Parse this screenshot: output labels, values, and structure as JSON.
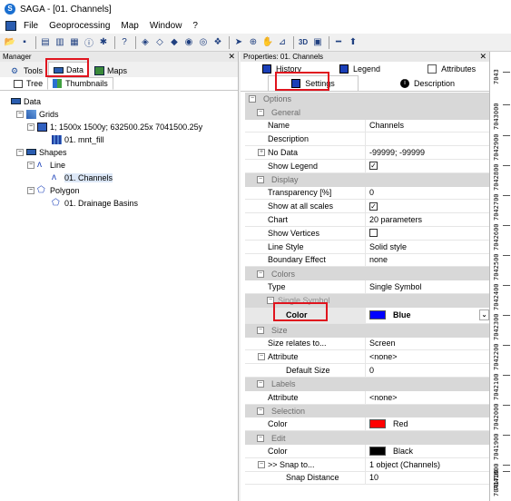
{
  "window": {
    "title": "SAGA - [01. Channels]"
  },
  "menu": [
    "File",
    "Geoprocessing",
    "Map",
    "Window",
    "?"
  ],
  "manager": {
    "title": "Manager",
    "tabs": [
      "Tools",
      "Data",
      "Maps"
    ],
    "subtabs": [
      "Tree",
      "Thumbnails"
    ],
    "tree": {
      "root": "Data",
      "grids": "Grids",
      "grid_system": "1; 1500x 1500y; 632500.25x 7041500.25y",
      "grid_item": "01. mnt_fill",
      "shapes": "Shapes",
      "line": "Line",
      "line_item": "01. Channels",
      "polygon": "Polygon",
      "polygon_item": "01. Drainage Basins"
    }
  },
  "properties": {
    "title": "Properties: 01. Channels",
    "tabs_top": [
      "History",
      "Legend",
      "Attributes"
    ],
    "tabs_bottom": [
      "Settings",
      "Description"
    ],
    "options": "Options",
    "general": "General",
    "name_k": "Name",
    "name_v": "Channels",
    "desc_k": "Description",
    "desc_v": "",
    "nodata_k": "No Data",
    "nodata_v": "-99999; -99999",
    "legend_k": "Show Legend",
    "display": "Display",
    "transp_k": "Transparency [%]",
    "transp_v": "0",
    "allscales_k": "Show at all scales",
    "chart_k": "Chart",
    "chart_v": "20 parameters",
    "vertices_k": "Show Vertices",
    "linestyle_k": "Line Style",
    "linestyle_v": "Solid style",
    "boundary_k": "Boundary Effect",
    "boundary_v": "none",
    "colors": "Colors",
    "type_k": "Type",
    "type_v": "Single Symbol",
    "single_symbol": "Single Symbol",
    "color_k": "Color",
    "color_v": "Blue",
    "color_hex": "#0000ff",
    "size": "Size",
    "sizerel_k": "Size relates to...",
    "sizerel_v": "Screen",
    "attr_k": "Attribute",
    "attr_v": "<none>",
    "defsize_k": "Default Size",
    "defsize_v": "0",
    "labels": "Labels",
    "lblattr_k": "Attribute",
    "lblattr_v": "<none>",
    "selection": "Selection",
    "selcolor_k": "Color",
    "selcolor_v": "Red",
    "selcolor_hex": "#ff0000",
    "edit": "Edit",
    "editcolor_k": "Color",
    "editcolor_v": "Black",
    "editcolor_hex": "#000000",
    "snapto_k": ">> Snap to...",
    "snapto_v": "1 object (Channels)",
    "snapdist_k": "Snap Distance",
    "snapdist_v": "10"
  },
  "ruler": [
    "7043",
    "7043000",
    "7042900",
    "7042800",
    "7042700",
    "7042600",
    "7042500",
    "7042400",
    "7042300",
    "7042200",
    "7042100",
    "7042000",
    "7041900",
    "7041800",
    "7041700"
  ]
}
